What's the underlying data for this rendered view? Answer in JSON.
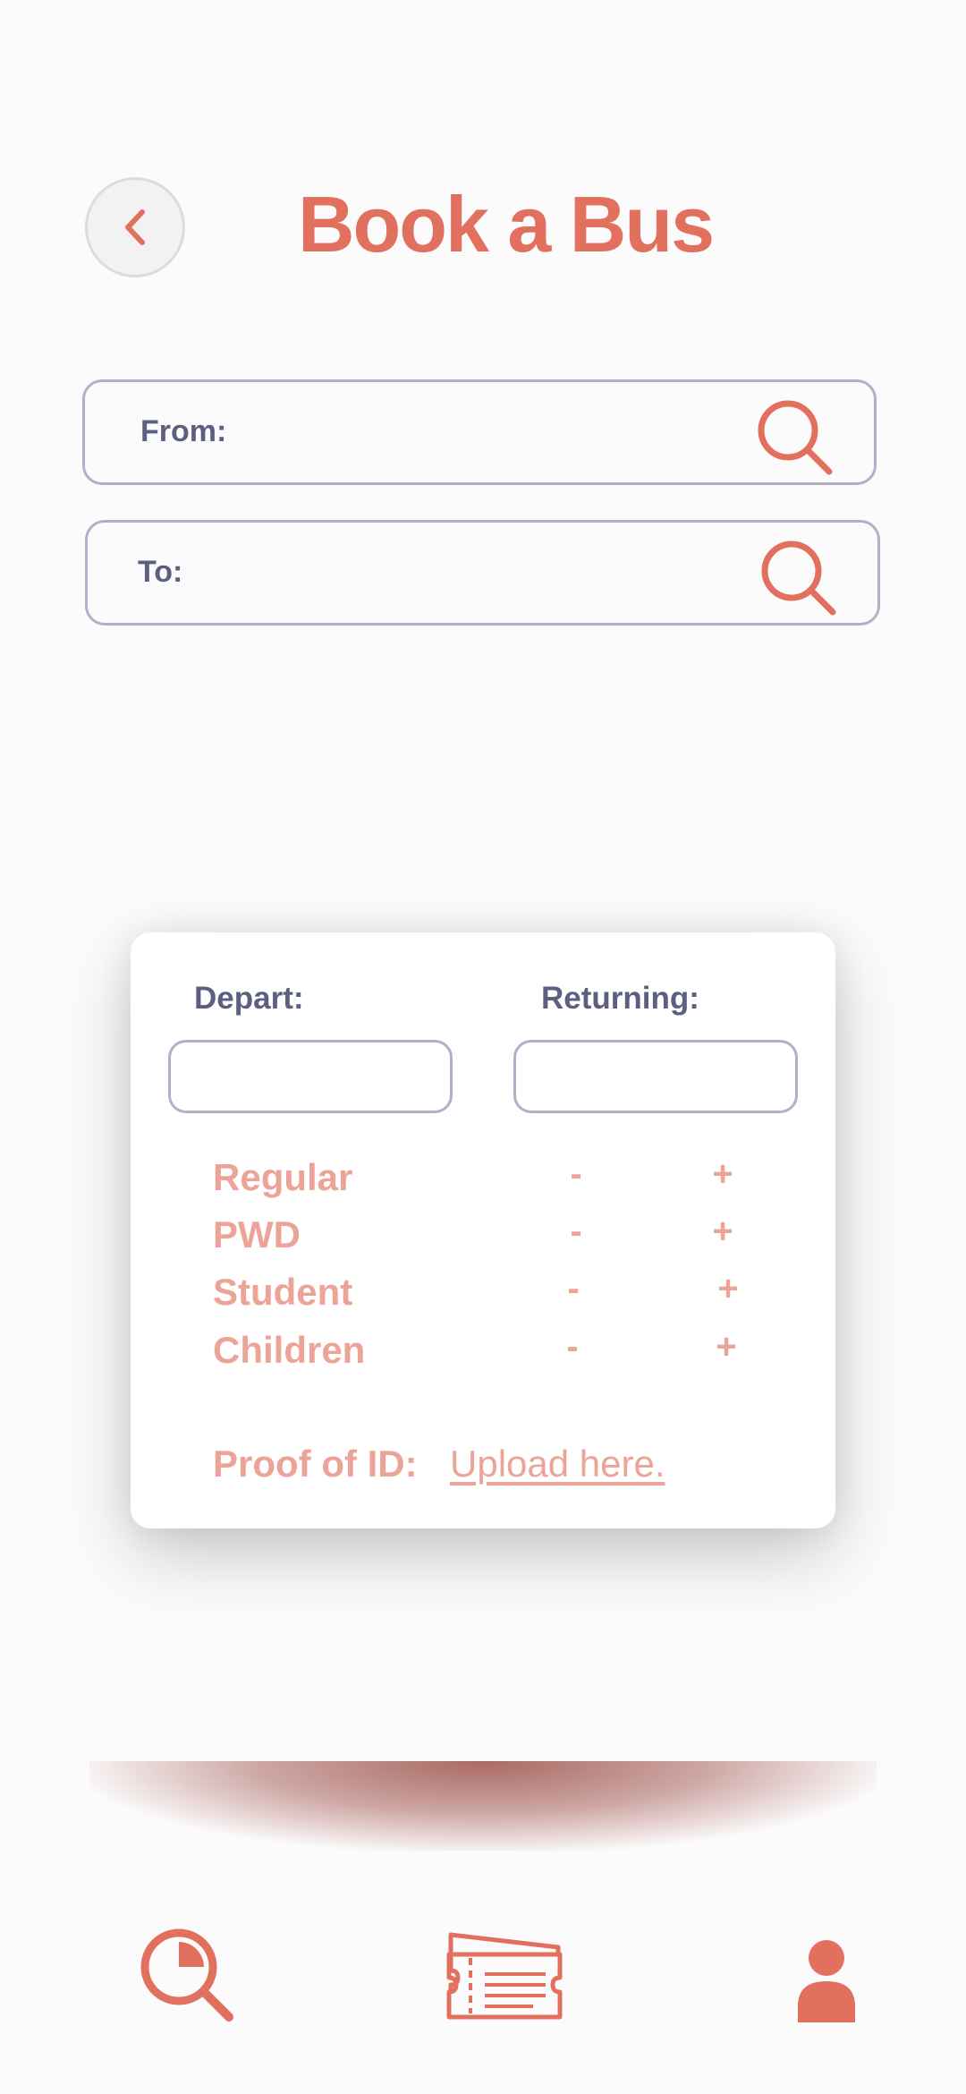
{
  "header": {
    "title": "Book a Bus",
    "back_icon": "chevron-left-icon"
  },
  "search": {
    "from_label": "From:",
    "to_label": "To:",
    "icon": "search-icon"
  },
  "booking": {
    "depart_label": "Depart:",
    "returning_label": "Returning:",
    "depart_value": "",
    "returning_value": "",
    "passengers": [
      {
        "type": "Regular",
        "minus": "-",
        "plus": "+"
      },
      {
        "type": "PWD",
        "minus": "-",
        "plus": "+"
      },
      {
        "type": "Student",
        "minus": "-",
        "plus": "+"
      },
      {
        "type": "Children",
        "minus": "-",
        "plus": "+"
      }
    ],
    "proof_label": "Proof of ID:",
    "upload_link": "Upload here."
  },
  "nav": {
    "items": [
      {
        "icon": "search-icon"
      },
      {
        "icon": "ticket-icon"
      },
      {
        "icon": "profile-icon"
      }
    ]
  },
  "colors": {
    "accent": "#e2705f",
    "accent_light": "#eba497",
    "label": "#5c5f80",
    "border": "#b2b0c8",
    "background": "#fcfbfc"
  }
}
